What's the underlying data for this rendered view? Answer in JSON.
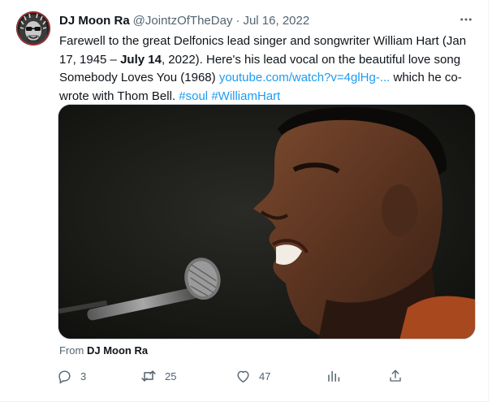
{
  "tweet": {
    "author_name": "DJ Moon Ra",
    "handle": "@JointzOfTheDay",
    "separator": "·",
    "date": "Jul 16, 2022",
    "more_icon": "more-horizontal-icon",
    "text": {
      "part1": "Farewell to the great Delfonics lead singer and songwriter William Hart (Jan 17, 1945 – ",
      "bold": "July 14",
      "part2": ", 2022). Here's his lead vocal on the beautiful love song Somebody Loves You (1968) ",
      "link": "youtube.com/watch?v=4glHg-...",
      "part3": " which he co-wrote with Thom Bell. ",
      "hashtag1": "#soul",
      "space": " ",
      "hashtag2": "#WilliamHart"
    },
    "media_description_icon": "video-thumbnail",
    "from_prefix": "From",
    "from_author": "DJ Moon Ra"
  },
  "actions": {
    "reply": {
      "icon": "reply-icon",
      "count": "3"
    },
    "retweet": {
      "icon": "retweet-icon",
      "count": "25"
    },
    "like": {
      "icon": "heart-icon",
      "count": "47"
    },
    "views": {
      "icon": "analytics-icon"
    },
    "share": {
      "icon": "share-icon"
    }
  },
  "colors": {
    "link": "#1d9bf0",
    "secondary_text": "#536471",
    "primary_text": "#0f1419",
    "border": "#cfd9de"
  }
}
